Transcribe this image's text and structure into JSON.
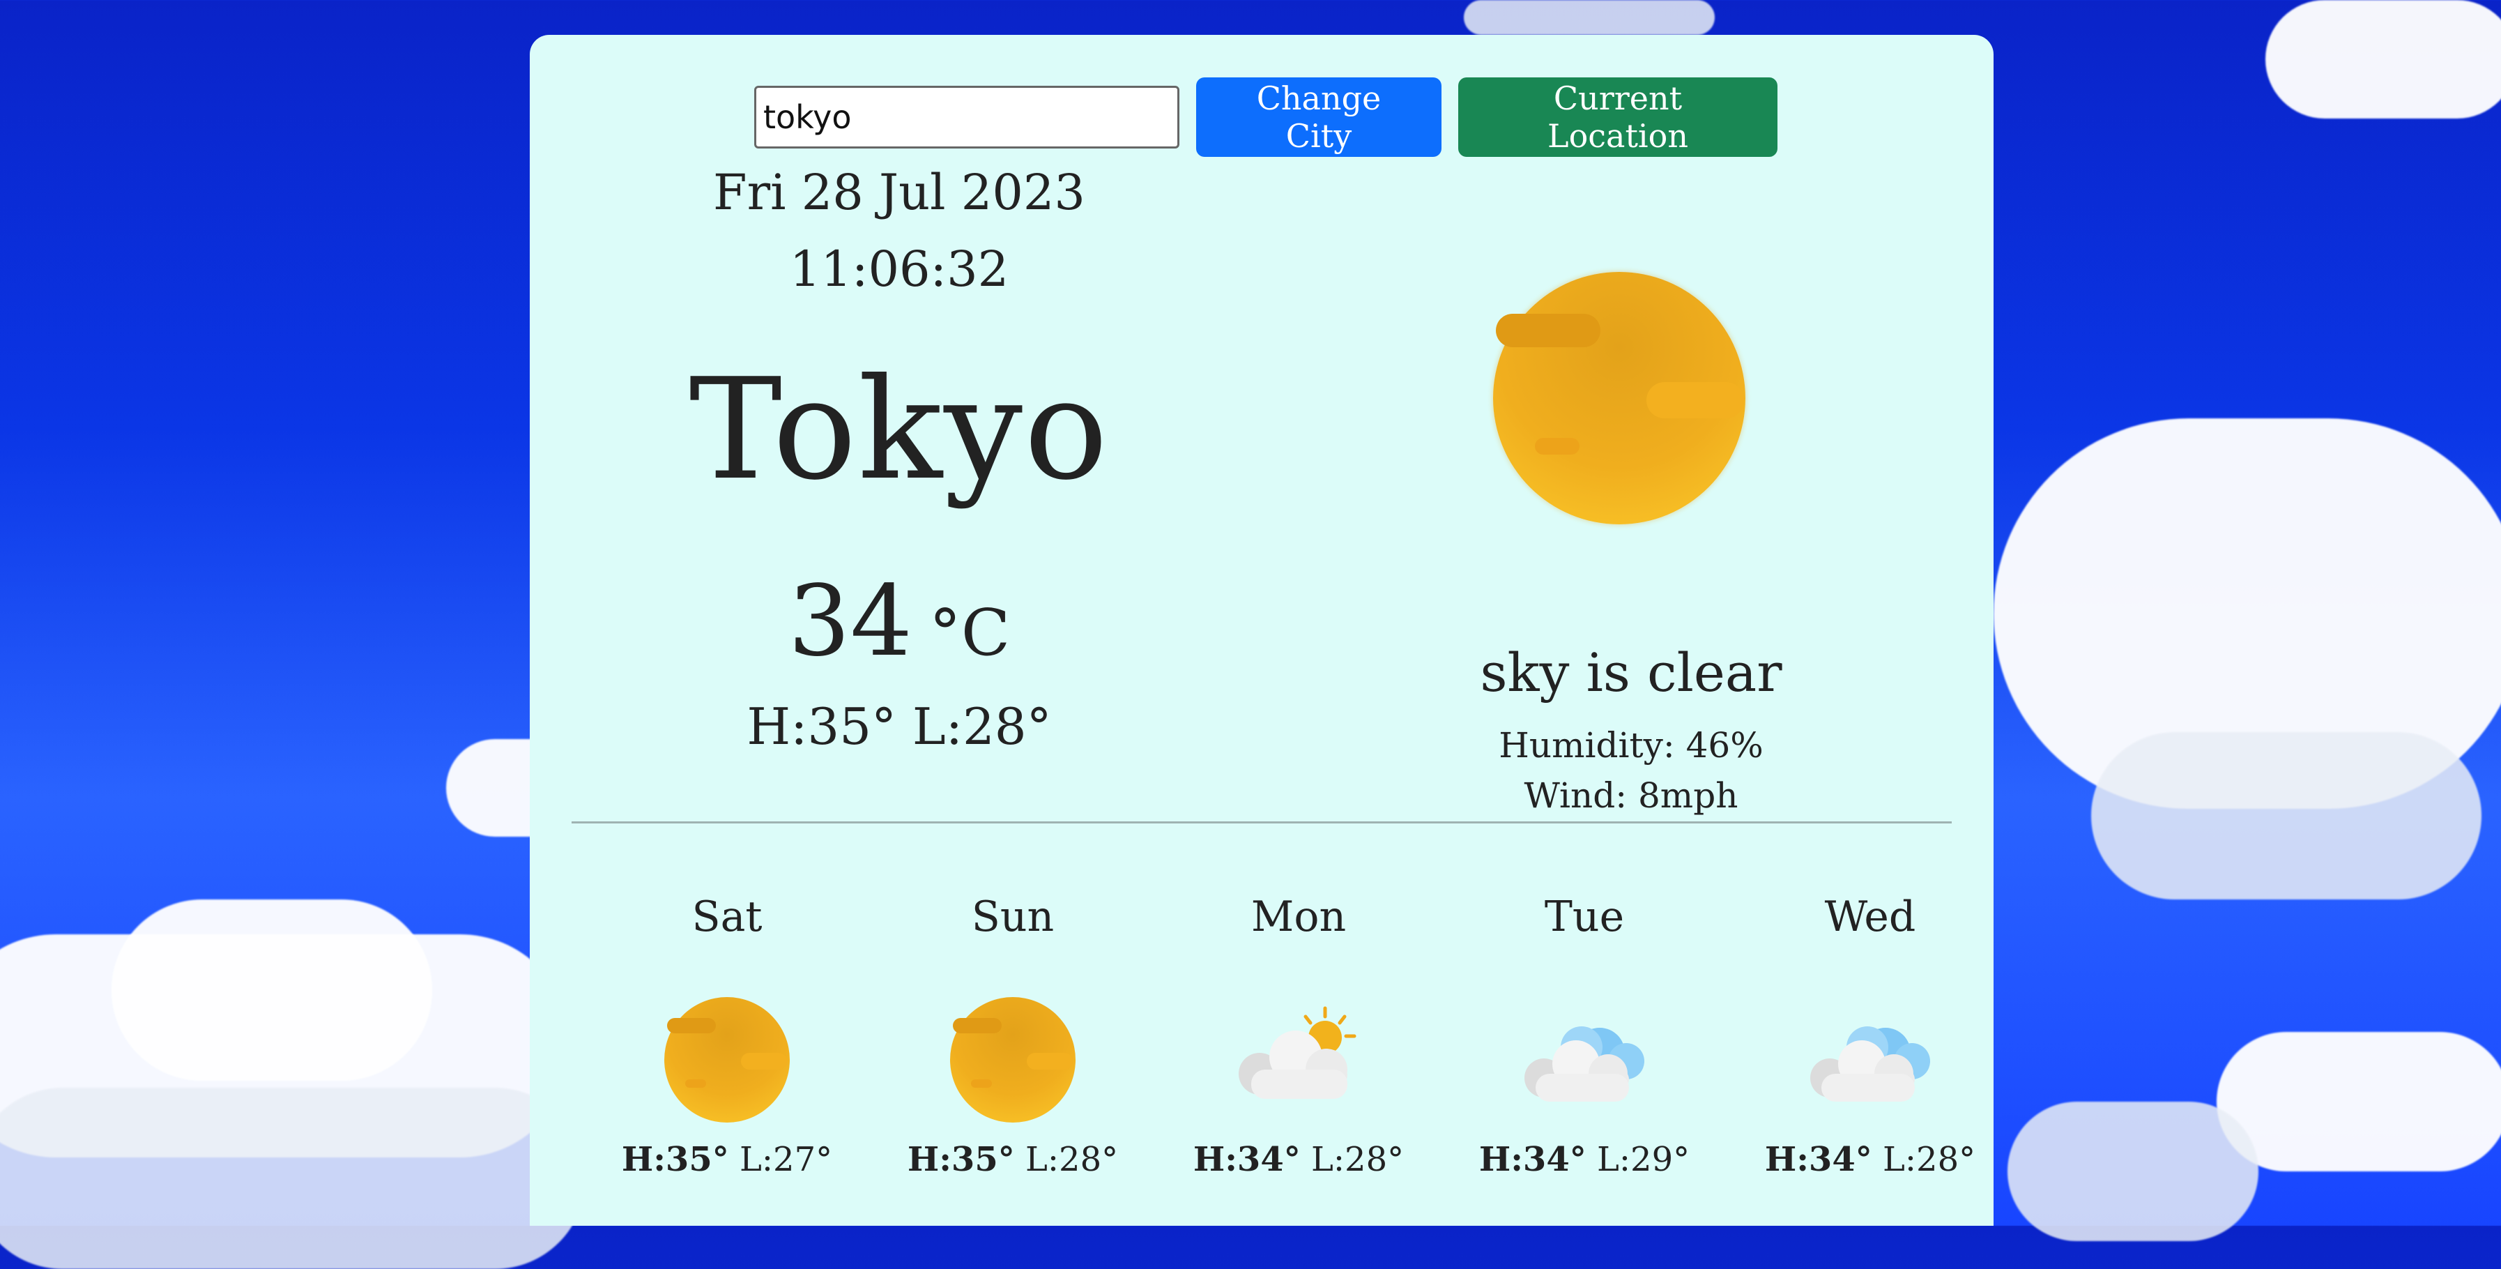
{
  "search": {
    "value": "tokyo"
  },
  "buttons": {
    "change_city": "Change City",
    "current_location": "Current Location"
  },
  "current": {
    "date": "Fri 28 Jul 2023",
    "time": "11:06:32",
    "city": "Tokyo",
    "temp": "34",
    "unit": "°C",
    "hilo": "H:35° L:28°",
    "icon": "sun-icon",
    "description": "sky is clear",
    "humidity": "Humidity: 46%",
    "wind": "Wind: 8mph"
  },
  "forecast": [
    {
      "day": "Sat",
      "icon": "sun-icon",
      "high": "H:35°",
      "low": "L:27°"
    },
    {
      "day": "Sun",
      "icon": "sun-icon",
      "high": "H:35°",
      "low": "L:28°"
    },
    {
      "day": "Mon",
      "icon": "partly-cloudy-icon",
      "high": "H:34°",
      "low": "L:28°"
    },
    {
      "day": "Tue",
      "icon": "cloud-icon",
      "high": "H:34°",
      "low": "L:29°"
    },
    {
      "day": "Wed",
      "icon": "cloud-icon",
      "high": "H:34°",
      "low": "L:28°"
    }
  ],
  "colors": {
    "card_bg": "#dcfcf9",
    "change_city_button": "#0d6efd",
    "current_location_button": "#198754",
    "sky": "#0b36e6"
  }
}
